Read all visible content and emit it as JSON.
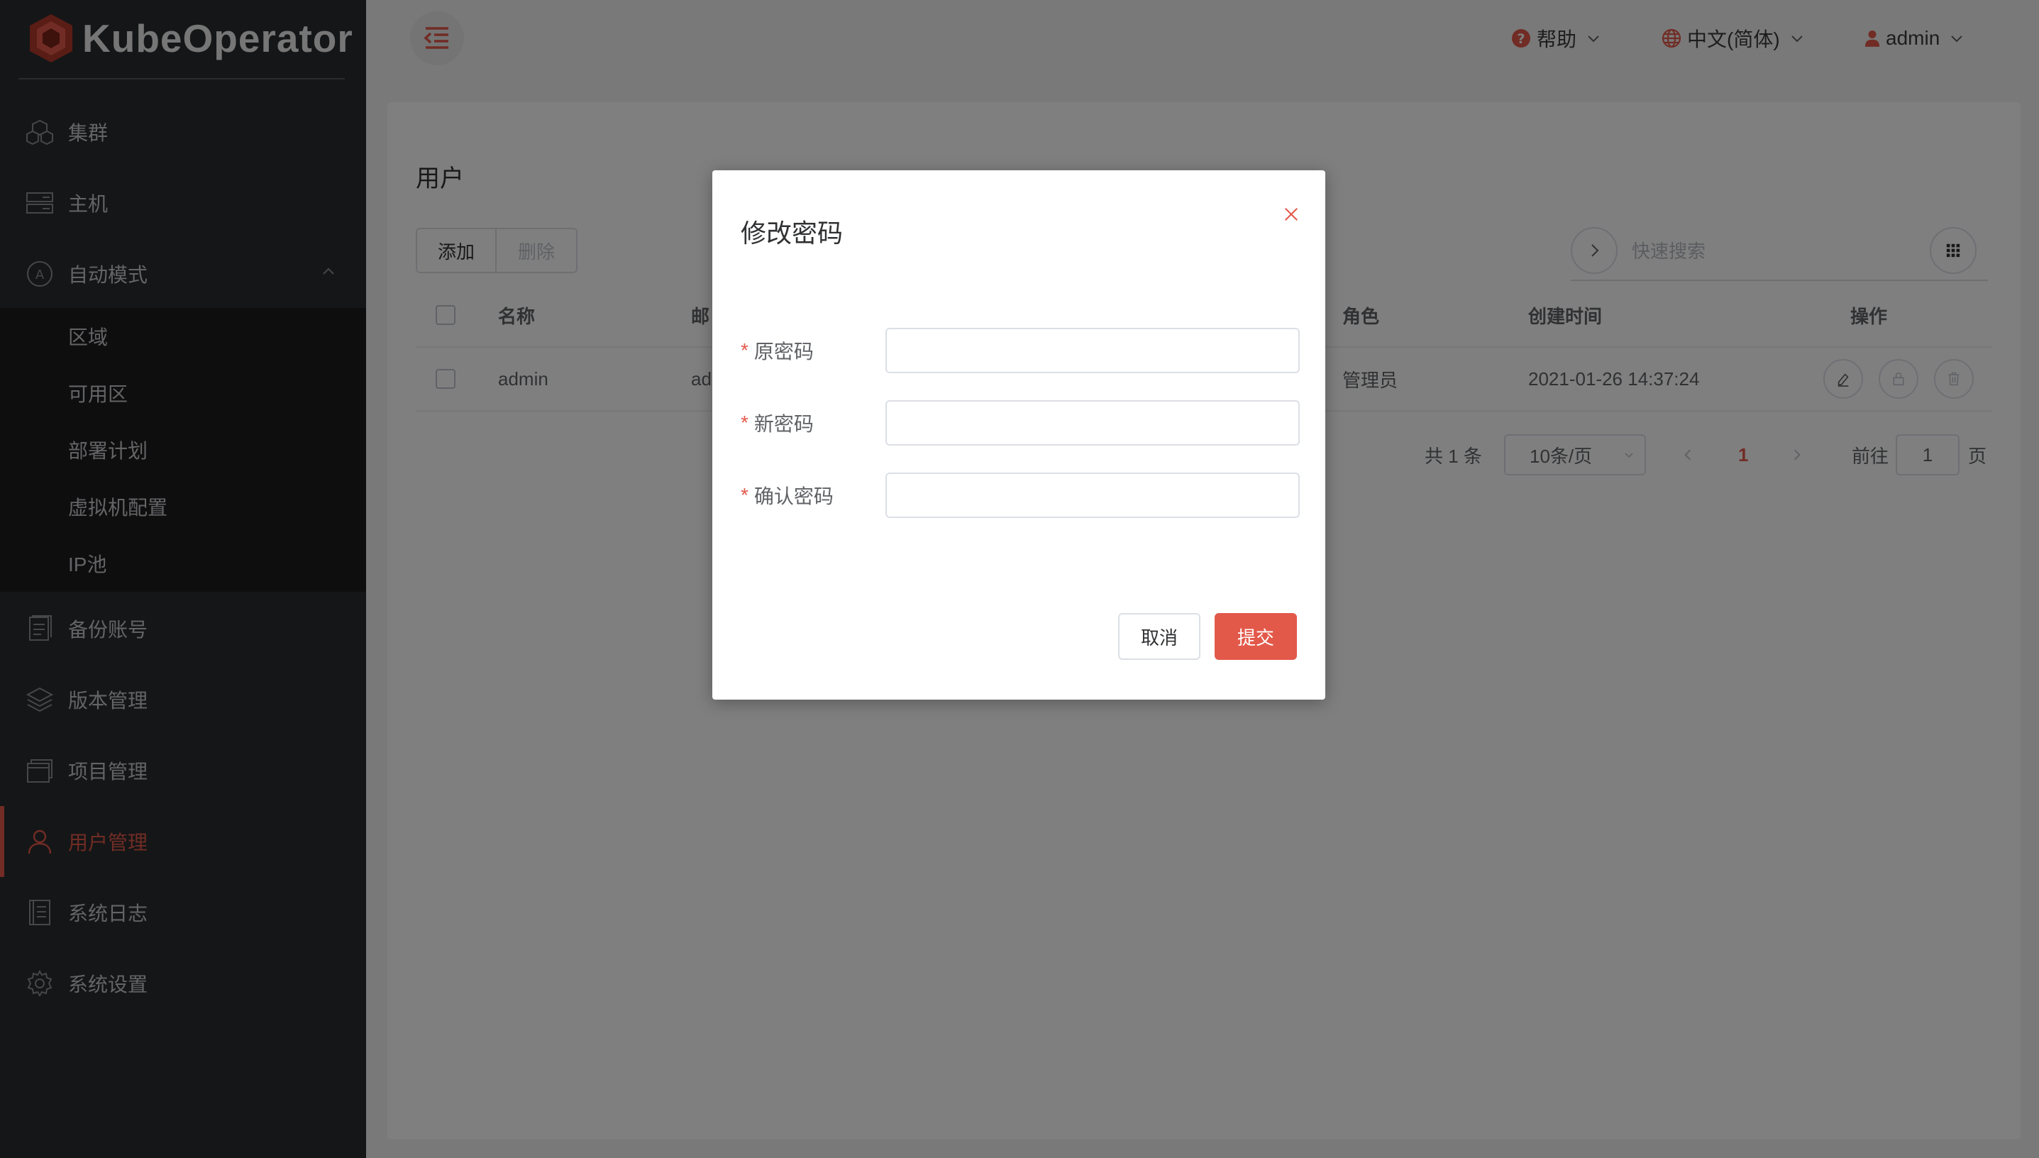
{
  "brand": {
    "name": "KubeOperator",
    "accent": "#e2594a"
  },
  "header": {
    "help": "帮助",
    "language": "中文(简体)",
    "user": "admin"
  },
  "sidebar": {
    "items": [
      {
        "label": "集群",
        "icon": "cubes-icon"
      },
      {
        "label": "主机",
        "icon": "server-icon"
      },
      {
        "label": "自动模式",
        "icon": "auto-mode-icon"
      },
      {
        "label": "备份账号",
        "icon": "backup-icon"
      },
      {
        "label": "版本管理",
        "icon": "layers-icon"
      },
      {
        "label": "项目管理",
        "icon": "project-icon"
      },
      {
        "label": "用户管理",
        "icon": "user-icon"
      },
      {
        "label": "系统日志",
        "icon": "log-icon"
      },
      {
        "label": "系统设置",
        "icon": "gear-icon"
      }
    ],
    "submenu": [
      "区域",
      "可用区",
      "部署计划",
      "虚拟机配置",
      "IP池"
    ],
    "active": "用户管理"
  },
  "page": {
    "title": "用户",
    "add_label": "添加",
    "delete_label": "删除",
    "search_placeholder": "快速搜索"
  },
  "table": {
    "columns": [
      "名称",
      "邮",
      "角色",
      "创建时间",
      "操作"
    ],
    "rows": [
      {
        "name": "admin",
        "email": "ad",
        "role": "管理员",
        "created": "2021-01-26 14:37:24"
      }
    ]
  },
  "pagination": {
    "total": "共 1 条",
    "page_size": "10条/页",
    "current": "1",
    "goto_label": "前往",
    "goto_value": "1",
    "page_suffix": "页"
  },
  "dialog": {
    "title": "修改密码",
    "fields": [
      {
        "label": "原密码",
        "value": ""
      },
      {
        "label": "新密码",
        "value": ""
      },
      {
        "label": "确认密码",
        "value": ""
      }
    ],
    "cancel": "取消",
    "submit": "提交"
  }
}
